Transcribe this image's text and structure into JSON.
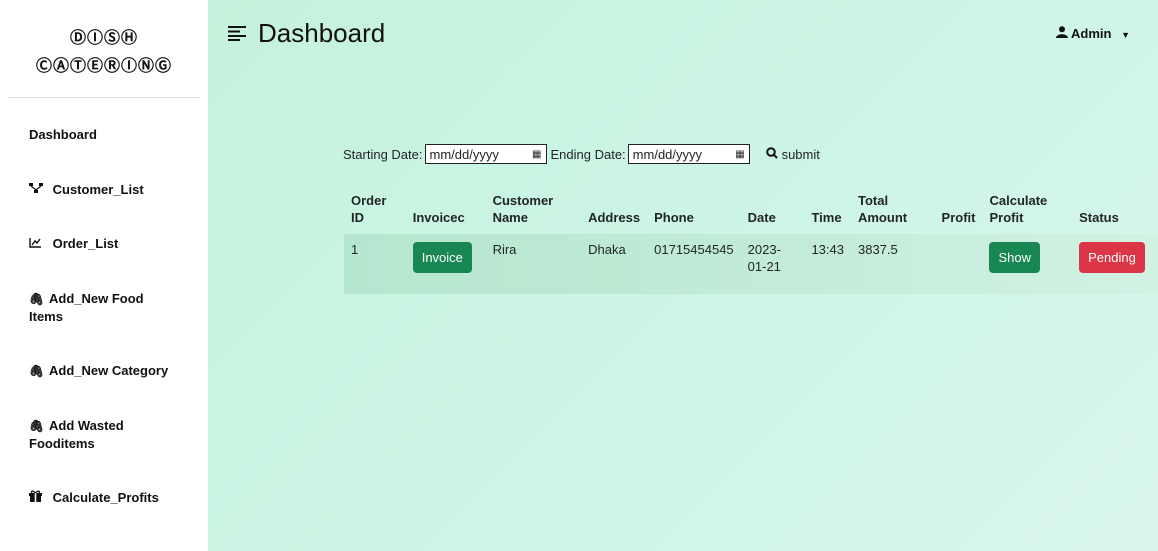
{
  "brand": {
    "line1": "ⒹⒾⓈⒽ",
    "line2": "ⒸⒶⓉⒺⓇⒾⓃⒼ"
  },
  "sidebar": {
    "items": [
      {
        "label": "Dashboard",
        "icon": ""
      },
      {
        "label": "Customer_List",
        "icon": "sitemap-icon"
      },
      {
        "label": "Order_List",
        "icon": "chart-line-icon"
      },
      {
        "label": "Add_New Food Items",
        "icon": "paperclip-icon"
      },
      {
        "label": "Add_New Category",
        "icon": "paperclip-icon"
      },
      {
        "label": "Add Wasted Fooditems",
        "icon": "paperclip-icon"
      },
      {
        "label": "Calculate_Profits",
        "icon": "gift-icon"
      }
    ]
  },
  "header": {
    "title": "Dashboard",
    "user": "Admin"
  },
  "filter": {
    "start_label": "Starting Date:",
    "start_value": "mm/dd/yyyy",
    "end_label": "Ending Date:",
    "end_value": "mm/dd/yyyy",
    "submit_label": "submit"
  },
  "table": {
    "headers": [
      "Order ID",
      "Invoicec",
      "Customer Name",
      "Address",
      "Phone",
      "Date",
      "Time",
      "Total Amount",
      "Profit",
      "Calculate Profit",
      "Status"
    ],
    "rows": [
      {
        "order_id": "1",
        "invoice_label": "Invoice",
        "customer_name": "Rira",
        "address": "Dhaka",
        "phone": "01715454545",
        "date": "2023-01-21",
        "time": "13:43",
        "total_amount": "3837.5",
        "profit": "",
        "calc_label": "Show",
        "status": "Pending"
      }
    ]
  },
  "colors": {
    "green": "#198754",
    "red": "#dc3545",
    "bg": "#c8f4e0"
  }
}
